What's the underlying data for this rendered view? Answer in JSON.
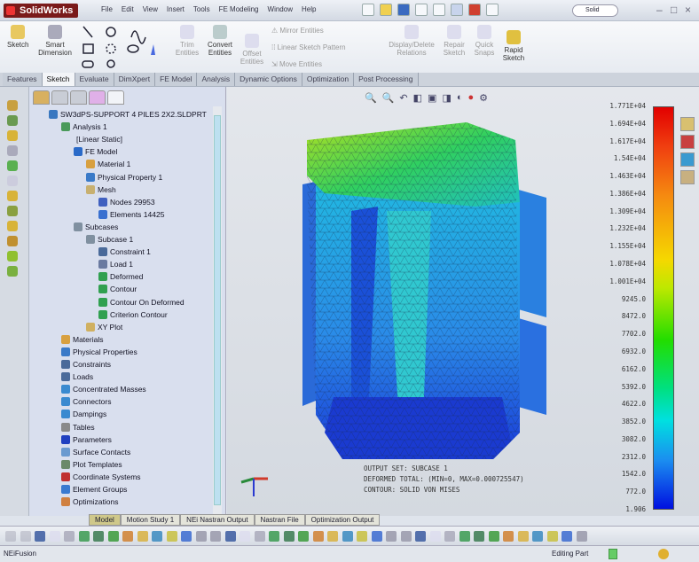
{
  "app": {
    "name": "SolidWorks",
    "menu": [
      "File",
      "Edit",
      "View",
      "Insert",
      "Tools",
      "FE Modeling",
      "Window",
      "Help"
    ],
    "search_placeholder": "Solid"
  },
  "ribbon": {
    "sketch": "Sketch",
    "smart_dimension": "Smart Dimension",
    "trim_entities": "Trim Entities",
    "convert_entities": "Convert Entities",
    "offset_entities": "Offset Entities",
    "mirror_entities": "Mirror Entities",
    "linear_sketch_pattern": "Linear Sketch Pattern",
    "move_entities": "Move Entities",
    "display_delete_relations": "Display/Delete Relations",
    "repair_sketch": "Repair Sketch",
    "quick_snaps": "Quick Snaps",
    "rapid_sketch": "Rapid Sketch"
  },
  "tabs": [
    "Features",
    "Sketch",
    "Evaluate",
    "DimXpert",
    "FE Model",
    "Analysis",
    "Dynamic Options",
    "Optimization",
    "Post Processing"
  ],
  "active_tab": "Sketch",
  "tree": [
    {
      "label": "SW3dPS-SUPPORT 4 PILES 2X2.SLDPRT",
      "level": 0,
      "color": "#3a78c0"
    },
    {
      "label": "Analysis 1",
      "level": 1,
      "color": "#4a9a5a"
    },
    {
      "label": "[Linear Static]",
      "level": 2,
      "color": ""
    },
    {
      "label": "FE Model",
      "level": 2,
      "color": "#2a6ac8"
    },
    {
      "label": "Material 1",
      "level": 3,
      "color": "#d8a040"
    },
    {
      "label": "Physical Property 1",
      "level": 3,
      "color": "#3a7ac8"
    },
    {
      "label": "Mesh",
      "level": 3,
      "color": "#c8b070"
    },
    {
      "label": "Nodes 29953",
      "level": 4,
      "color": "#4060c0"
    },
    {
      "label": "Elements 14425",
      "level": 4,
      "color": "#3a70d0"
    },
    {
      "label": "Subcases",
      "level": 2,
      "color": "#8090a0"
    },
    {
      "label": "Subcase 1",
      "level": 3,
      "color": "#8090a0"
    },
    {
      "label": "Constraint 1",
      "level": 4,
      "color": "#4a6a9a"
    },
    {
      "label": "Load 1",
      "level": 4,
      "color": "#6a7aa0"
    },
    {
      "label": "Deformed",
      "level": 4,
      "color": "#30a050"
    },
    {
      "label": "Contour",
      "level": 4,
      "color": "#30a050"
    },
    {
      "label": "Contour On Deformed",
      "level": 4,
      "color": "#30a050"
    },
    {
      "label": "Criterion Contour",
      "level": 4,
      "color": "#30a050"
    },
    {
      "label": "XY Plot",
      "level": 3,
      "color": "#d0b060"
    },
    {
      "label": "Materials",
      "level": 1,
      "color": "#d8a040"
    },
    {
      "label": "Physical Properties",
      "level": 1,
      "color": "#3a7ac8"
    },
    {
      "label": "Constraints",
      "level": 1,
      "color": "#4a6a9a"
    },
    {
      "label": "Loads",
      "level": 1,
      "color": "#4a6a9a"
    },
    {
      "label": "Concentrated Masses",
      "level": 1,
      "color": "#3a8ad0"
    },
    {
      "label": "Connectors",
      "level": 1,
      "color": "#3a8ad0"
    },
    {
      "label": "Dampings",
      "level": 1,
      "color": "#3a8ad0"
    },
    {
      "label": "Tables",
      "level": 1,
      "color": "#8a8a8a"
    },
    {
      "label": "Parameters",
      "level": 1,
      "color": "#2040c0"
    },
    {
      "label": "Surface Contacts",
      "level": 1,
      "color": "#6a9ad0"
    },
    {
      "label": "Plot Templates",
      "level": 1,
      "color": "#6a8a6a"
    },
    {
      "label": "Coordinate Systems",
      "level": 1,
      "color": "#c03030"
    },
    {
      "label": "Element Groups",
      "level": 1,
      "color": "#3a7ad0"
    },
    {
      "label": "Optimizations",
      "level": 1,
      "color": "#d08040"
    }
  ],
  "legend": {
    "labels": [
      "1.771E+04",
      "1.694E+04",
      "1.617E+04",
      "1.54E+04",
      "1.463E+04",
      "1.386E+04",
      "1.309E+04",
      "1.232E+04",
      "1.155E+04",
      "1.078E+04",
      "1.001E+04",
      "9245.0",
      "8472.0",
      "7702.0",
      "6932.0",
      "6162.0",
      "5392.0",
      "4622.0",
      "3852.0",
      "3082.0",
      "2312.0",
      "1542.0",
      "772.0",
      "1.906"
    ]
  },
  "output": {
    "line1": "OUTPUT SET: SUBCASE 1",
    "line2": "DEFORMED TOTAL: (MIN=0, MAX=0.000725547)",
    "line3": "CONTOUR: SOLID VON MISES"
  },
  "bottom_tabs": [
    "Model",
    "Motion Study 1",
    "NEi Nastran Output",
    "Nastran File",
    "Optimization Output"
  ],
  "status": {
    "left": "NEiFusion",
    "right": "Editing Part"
  }
}
